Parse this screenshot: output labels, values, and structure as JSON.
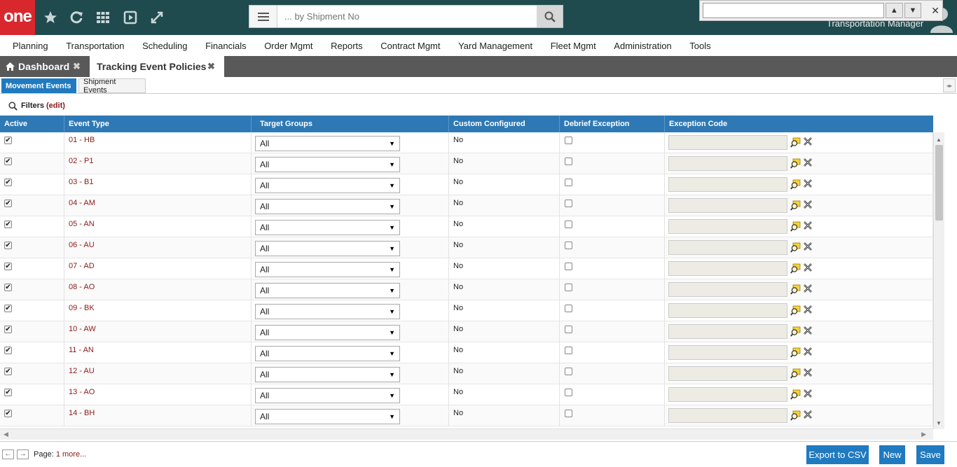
{
  "header": {
    "logo_text": "one",
    "search_placeholder": "... by Shipment No",
    "user_role": "Transportation Manager",
    "icons": [
      "star-icon",
      "refresh-icon",
      "apps-grid-icon",
      "play-icon",
      "expand-icon",
      "menu-icon",
      "search-icon",
      "user-avatar-icon"
    ]
  },
  "find_bar": {
    "value": "",
    "up": "▲",
    "down": "▼",
    "close": "✕"
  },
  "menu": [
    "Planning",
    "Transportation",
    "Scheduling",
    "Financials",
    "Order Mgmt",
    "Reports",
    "Contract Mgmt",
    "Yard Management",
    "Fleet Mgmt",
    "Administration",
    "Tools"
  ],
  "tabs": {
    "dashboard": "Dashboard",
    "current": "Tracking Event Policies",
    "close": "✖"
  },
  "subtabs": {
    "movement": "Movement Events",
    "shipment": "Shipment Events"
  },
  "filters": {
    "label": "Filters",
    "edit": "(edit)"
  },
  "grid": {
    "columns": [
      "Active",
      "Event Type",
      "Target Groups",
      "Custom Configured",
      "Debrief Exception",
      "Exception Code"
    ],
    "rows": [
      {
        "active": true,
        "event_type": "01 - HB",
        "target_group": "All",
        "custom": "No",
        "debrief": false,
        "code": ""
      },
      {
        "active": true,
        "event_type": "02 - P1",
        "target_group": "All",
        "custom": "No",
        "debrief": false,
        "code": ""
      },
      {
        "active": true,
        "event_type": "03 - B1",
        "target_group": "All",
        "custom": "No",
        "debrief": false,
        "code": ""
      },
      {
        "active": true,
        "event_type": "04 - AM",
        "target_group": "All",
        "custom": "No",
        "debrief": false,
        "code": ""
      },
      {
        "active": true,
        "event_type": "05 - AN",
        "target_group": "All",
        "custom": "No",
        "debrief": false,
        "code": ""
      },
      {
        "active": true,
        "event_type": "06 - AU",
        "target_group": "All",
        "custom": "No",
        "debrief": false,
        "code": ""
      },
      {
        "active": true,
        "event_type": "07 - AD",
        "target_group": "All",
        "custom": "No",
        "debrief": false,
        "code": ""
      },
      {
        "active": true,
        "event_type": "08 - AO",
        "target_group": "All",
        "custom": "No",
        "debrief": false,
        "code": ""
      },
      {
        "active": true,
        "event_type": "09 - BK",
        "target_group": "All",
        "custom": "No",
        "debrief": false,
        "code": ""
      },
      {
        "active": true,
        "event_type": "10 - AW",
        "target_group": "All",
        "custom": "No",
        "debrief": false,
        "code": ""
      },
      {
        "active": true,
        "event_type": "11 - AN",
        "target_group": "All",
        "custom": "No",
        "debrief": false,
        "code": ""
      },
      {
        "active": true,
        "event_type": "12 - AU",
        "target_group": "All",
        "custom": "No",
        "debrief": false,
        "code": ""
      },
      {
        "active": true,
        "event_type": "13 - AO",
        "target_group": "All",
        "custom": "No",
        "debrief": false,
        "code": ""
      },
      {
        "active": true,
        "event_type": "14 - BH",
        "target_group": "All",
        "custom": "No",
        "debrief": false,
        "code": ""
      }
    ]
  },
  "footer": {
    "page_label": "Page:",
    "page_number": "1",
    "more": "more...",
    "export": "Export to CSV",
    "new": "New",
    "save": "Save"
  },
  "colors": {
    "topbar": "#1f4b4f",
    "logo": "#d9272e",
    "accent": "#1f7ac0",
    "link": "#8a1a1a"
  }
}
